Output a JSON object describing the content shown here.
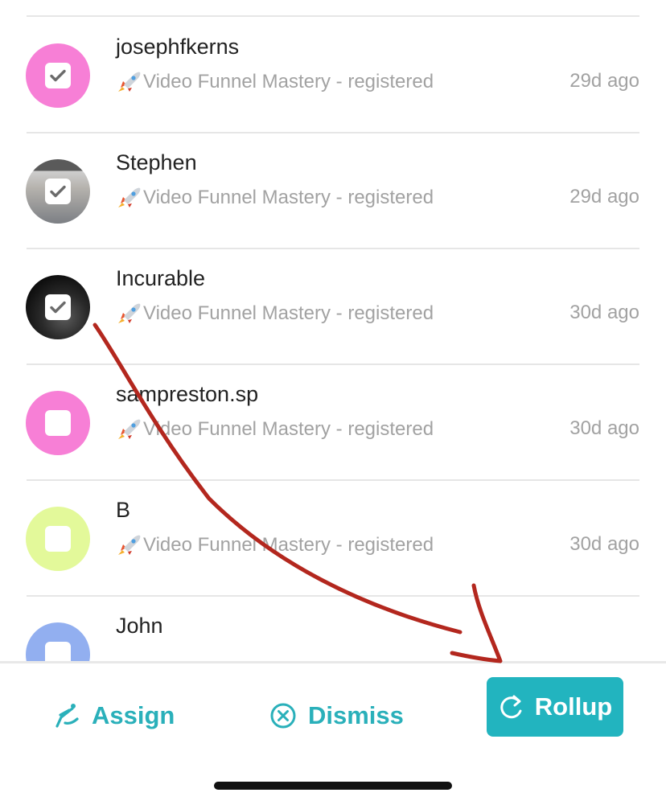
{
  "contacts": [
    {
      "name": "josephfkerns",
      "subtitle": "Video Funnel Mastery - registered",
      "time": "29d ago",
      "avatar_color": "#f77fd6",
      "checked": true
    },
    {
      "name": "Stephen",
      "subtitle": "Video Funnel Mastery - registered",
      "time": "29d ago",
      "avatar_color": "#8e8e8e",
      "checked": true
    },
    {
      "name": "Incurable",
      "subtitle": "Video Funnel Mastery - registered",
      "time": "30d ago",
      "avatar_color": "#1b1b1b",
      "checked": true
    },
    {
      "name": "sampreston.sp",
      "subtitle": "Video Funnel Mastery - registered",
      "time": "30d ago",
      "avatar_color": "#f77fd6",
      "checked": false
    },
    {
      "name": "B",
      "subtitle": "Video Funnel Mastery - registered",
      "time": "30d ago",
      "avatar_color": "#e3f99a",
      "checked": false
    },
    {
      "name": "John",
      "subtitle": "",
      "time": "",
      "avatar_color": "#92aff0",
      "checked": false
    }
  ],
  "actions": {
    "assign_label": "Assign",
    "dismiss_label": "Dismiss",
    "rollup_label": "Rollup"
  },
  "colors": {
    "accent": "#22b4bf",
    "annotation_stroke": "#b3271e"
  },
  "icons": {
    "assign": "assign-pen-icon",
    "dismiss": "dismiss-x-circle-icon",
    "rollup": "refresh-arrow-icon",
    "subtitle_prefix": "rocket-icon",
    "check": "checkmark-icon"
  }
}
